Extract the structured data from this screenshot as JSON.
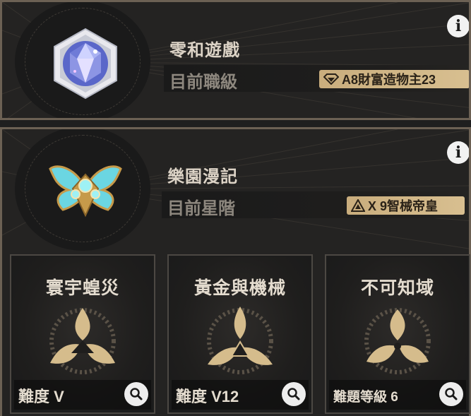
{
  "top_panel": {
    "title": "零和遊戲",
    "sub_label": "目前職級",
    "badge_text": "A8財富造物主23",
    "info": "i"
  },
  "mid_panel": {
    "title": "樂園漫記",
    "sub_label": "目前星階",
    "badge_text": "X 9智械帝皇",
    "info": "i"
  },
  "cards": [
    {
      "title": "寰宇蝗災",
      "difficulty": "難度 V"
    },
    {
      "title": "黃金與機械",
      "difficulty": "難度 V12"
    },
    {
      "title": "不可知域",
      "difficulty": "難題等級 6"
    }
  ],
  "colors": {
    "gold": "#d5bc8c",
    "panel_border": "#6c6154",
    "text": "#dcd3c6"
  }
}
